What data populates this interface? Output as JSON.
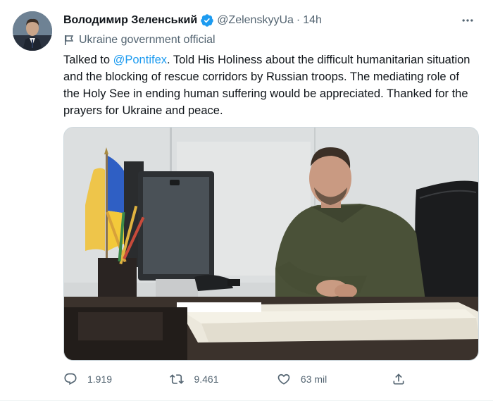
{
  "tweet": {
    "author_name": "Володимир Зеленський",
    "handle": "@ZelenskyyUa",
    "separator": "·",
    "time": "14h",
    "label": "Ukraine government official",
    "text_before_mention": "Talked to ",
    "mention": "@Pontifex",
    "text_after_mention": ". Told His Holiness about the difficult humanitarian situation and the blocking of rescue corridors by Russian troops. The mediating role of the Holy See in ending human suffering would be appreciated. Thanked for the prayers for Ukraine and peace.",
    "more_icon": "more-horizontal-icon",
    "verified_icon": "verified-badge-icon"
  },
  "actions": {
    "reply_count": "1.919",
    "retweet_count": "9.461",
    "like_count": "63 mil"
  },
  "colors": {
    "link": "#1d9bf0",
    "secondary_text": "#536471",
    "primary_text": "#0f1419",
    "verified": "#1d9bf0"
  }
}
